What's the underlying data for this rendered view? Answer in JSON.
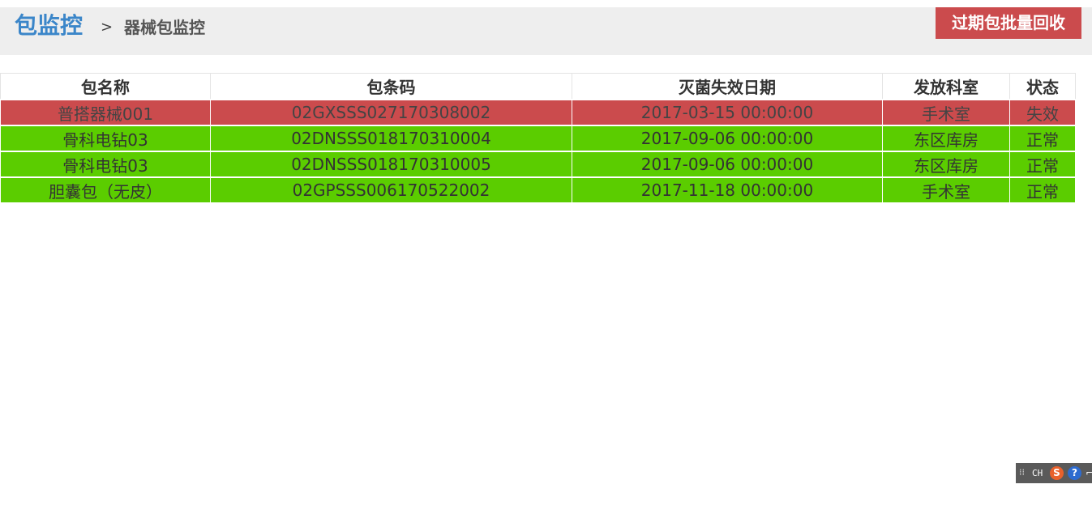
{
  "header": {
    "title": "包监控",
    "separator": ">",
    "breadcrumb": "器械包监控",
    "recycle_button_label": "过期包批量回收"
  },
  "table": {
    "columns": [
      "包名称",
      "包条码",
      "灭菌失效日期",
      "发放科室",
      "状态"
    ],
    "rows": [
      {
        "name": "普搭器械001",
        "barcode": "02GXSSS027170308002",
        "expiry": "2017-03-15 00:00:00",
        "department": "手术室",
        "status": "失效",
        "state": "expired"
      },
      {
        "name": "骨科电钻03",
        "barcode": "02DNSSS018170310004",
        "expiry": "2017-09-06 00:00:00",
        "department": "东区库房",
        "status": "正常",
        "state": "normal"
      },
      {
        "name": "骨科电钻03",
        "barcode": "02DNSSS018170310005",
        "expiry": "2017-09-06 00:00:00",
        "department": "东区库房",
        "status": "正常",
        "state": "normal"
      },
      {
        "name": "胆囊包（无皮）",
        "barcode": "02GPSSS006170522002",
        "expiry": "2017-11-18 00:00:00",
        "department": "手术室",
        "status": "正常",
        "state": "normal"
      }
    ]
  },
  "ime": {
    "lang": "CH",
    "grip_icon": "⁞⁞",
    "sogou_icon": "S",
    "help_icon": "?",
    "more_icon": "⌐"
  },
  "colors": {
    "title": "#3b86c9",
    "expired_row": "#cb4b4d",
    "normal_row": "#5bcd00",
    "button": "#cb4b4d"
  }
}
